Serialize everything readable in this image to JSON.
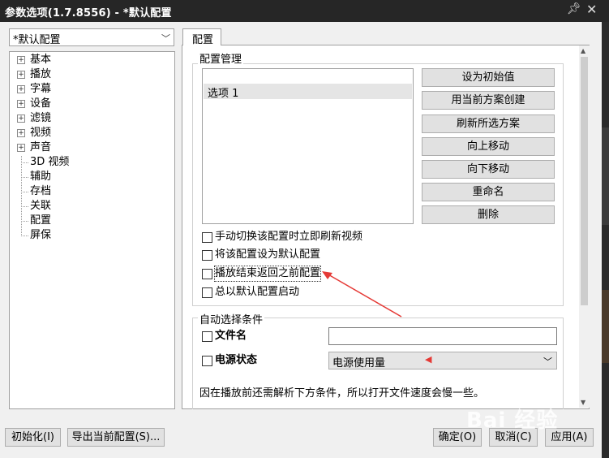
{
  "window": {
    "title": "参数选项(1.7.8556) - *默认配置",
    "pin_icon": "pin-icon",
    "close_icon": "close-icon"
  },
  "profile_combo": {
    "value": "*默认配置"
  },
  "tree": {
    "items": [
      {
        "label": "基本",
        "expandable": true
      },
      {
        "label": "播放",
        "expandable": true
      },
      {
        "label": "字幕",
        "expandable": true
      },
      {
        "label": "设备",
        "expandable": true
      },
      {
        "label": "滤镜",
        "expandable": true
      },
      {
        "label": "视频",
        "expandable": true
      },
      {
        "label": "声音",
        "expandable": true
      },
      {
        "label": "3D 视频",
        "expandable": false
      },
      {
        "label": "辅助",
        "expandable": false
      },
      {
        "label": "存档",
        "expandable": false
      },
      {
        "label": "关联",
        "expandable": false
      },
      {
        "label": "配置",
        "expandable": false
      },
      {
        "label": "屏保",
        "expandable": false
      }
    ]
  },
  "tab": {
    "label": "配置"
  },
  "config_group": {
    "title": "配置管理",
    "list_items": [
      "选项 1"
    ],
    "buttons": [
      "设为初始值",
      "用当前方案创建",
      "刷新所选方案",
      "向上移动",
      "向下移动",
      "重命名",
      "删除"
    ],
    "checkboxes": [
      {
        "label": "手动切换该配置时立即刷新视频",
        "checked": false
      },
      {
        "label": "将该配置设为默认配置",
        "checked": false
      },
      {
        "label": "播放结束返回之前配置",
        "checked": false
      },
      {
        "label": "总以默认配置启动",
        "checked": false
      }
    ]
  },
  "auto_group": {
    "title": "自动选择条件",
    "file_label": "文件名",
    "file_value": "",
    "power_label": "电源状态",
    "power_value": "电源使用量",
    "note": "因在播放前还需解析下方条件，所以打开文件速度会慢一些。"
  },
  "footer": {
    "init_button": "初始化(I)",
    "export_button": "导出当前配置(S)...",
    "ok_button": "确定(O)",
    "cancel_button": "取消(C)",
    "apply_button": "应用(A)"
  },
  "watermark": {
    "text": "Bai 经验"
  },
  "colors": {
    "annotation": "#e53935",
    "titlebar": "#262626"
  }
}
